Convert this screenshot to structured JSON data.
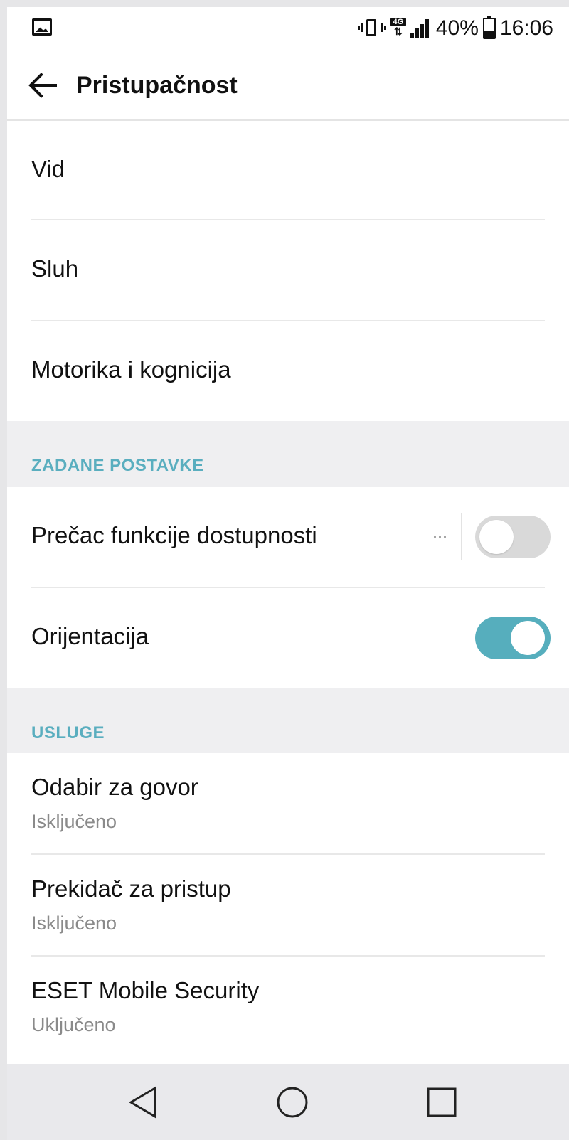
{
  "status_bar": {
    "left_icon": "image-icon",
    "icons": [
      "vibrate-icon",
      "4g-data-icon",
      "signal-icon"
    ],
    "network_tag": "4G",
    "battery_percent": "40%",
    "battery_level": 0.4,
    "time": "16:06"
  },
  "app_bar": {
    "back_icon": "arrow-back-icon",
    "title": "Pristupačnost"
  },
  "categories": [
    {
      "label": "Vid"
    },
    {
      "label": "Sluh"
    },
    {
      "label": "Motorika i kognicija"
    }
  ],
  "section_defaults": {
    "title": "ZADANE POSTAVKE",
    "items": [
      {
        "label": "Prečac funkcije dostupnosti",
        "has_more": true,
        "toggle": false
      },
      {
        "label": "Orijentacija",
        "toggle": true
      }
    ]
  },
  "section_services": {
    "title": "USLUGE",
    "items": [
      {
        "label": "Odabir za govor",
        "status": "Isključeno"
      },
      {
        "label": "Prekidač za pristup",
        "status": "Isključeno"
      },
      {
        "label": "ESET Mobile Security",
        "status": "Uključeno"
      }
    ]
  },
  "more_glyph": "···",
  "navigation": [
    "back-triangle-icon",
    "home-circle-icon",
    "recents-square-icon"
  ],
  "colors": {
    "accent": "#56aebd",
    "section_title": "#5aaebf",
    "toggle_off": "#d9d9d9",
    "section_bg": "#efeff1",
    "navbar_bg": "#e9e9ec"
  }
}
